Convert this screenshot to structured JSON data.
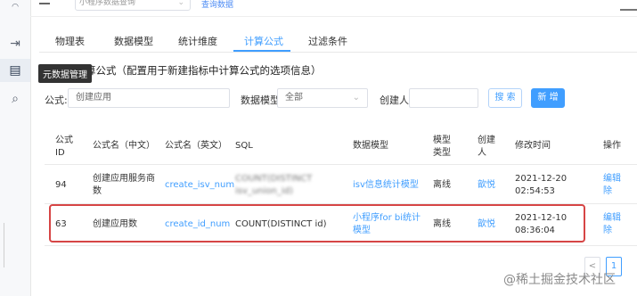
{
  "sidebar": {
    "tooltip": "元数据管理"
  },
  "topbar": {
    "program_select_value": "小程序数据查询",
    "link": "查询数据"
  },
  "tabs": [
    {
      "label": "物理表"
    },
    {
      "label": "数据模型"
    },
    {
      "label": "统计维度"
    },
    {
      "label": "计算公式"
    },
    {
      "label": "过滤条件"
    }
  ],
  "description": "：配置计算公式（配置用于新建指标中计算公式的选项信息）",
  "filters": {
    "formula_label": "公式:",
    "formula_value": "创建应用",
    "model_label": "数据模型:",
    "model_value": "全部",
    "creator_label": "创建人:",
    "creator_value": "",
    "search_label": "搜 索",
    "new_label": "新 增"
  },
  "table": {
    "headers": [
      "公式 ID",
      "公式名（中文）",
      "公式名（英文）",
      "SQL",
      "数据模型",
      "模型类型",
      "创建人",
      "修改时间",
      "操作"
    ],
    "rows": [
      {
        "id": "94",
        "name_cn": "创建应用服务商数",
        "name_en": "create_isv_num",
        "sql": "COUNT(DISTINCT isv_union_id)",
        "model": "isv信息统计模型",
        "model_type": "离线",
        "creator": "歆悦",
        "modified": "2021-12-20 02:54:53",
        "op_edit": "编辑",
        "op_del": "除"
      },
      {
        "id": "63",
        "name_cn": "创建应用数",
        "name_en": "create_id_num",
        "sql": "COUNT(DISTINCT id)",
        "model": "小程序for bi统计模型",
        "model_type": "离线",
        "creator": "歆悦",
        "modified": "2021-12-10 08:36:04",
        "op_edit": "编辑",
        "op_del": "除"
      }
    ]
  },
  "pagination": {
    "prev": "<",
    "current": "1"
  },
  "watermark": "@稀土掘金技术社区",
  "colors": {
    "accent": "#409eff",
    "highlight": "#d64545"
  }
}
